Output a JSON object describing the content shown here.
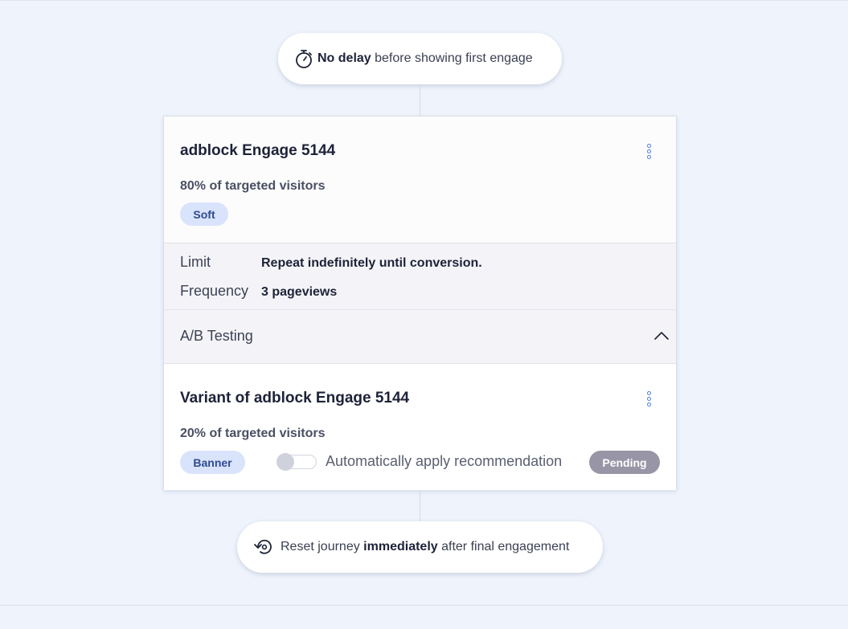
{
  "delay_pill": {
    "bold": "No delay",
    "rest": " before showing first engage",
    "icon": "stopwatch-icon"
  },
  "engage": {
    "title": "adblock Engage 5144",
    "percent_text": "80% of targeted visitors",
    "tag": "Soft",
    "menu_icon": "kebab-menu-icon"
  },
  "settings": {
    "limit_label": "Limit",
    "limit_value": "Repeat indefinitely until conversion.",
    "frequency_label": "Frequency",
    "frequency_value": "3 pageviews"
  },
  "ab_testing": {
    "label": "A/B Testing",
    "expanded": true,
    "icon": "chevron-up-icon"
  },
  "variant": {
    "title": "Variant of adblock Engage 5144",
    "percent_text": "20% of targeted visitors",
    "tag": "Banner",
    "auto_apply_label": "Automatically apply recommendation",
    "auto_apply_on": false,
    "status": "Pending"
  },
  "reset_pill": {
    "prefix": "Reset journey ",
    "bold": "immediately",
    "suffix": " after final engagement",
    "icon": "reset-icon"
  },
  "colors": {
    "background": "#eef3fc",
    "accent": "#4f7be0",
    "tag_bg": "#d9e3fb",
    "tag_text": "#2f4b8f",
    "pending_bg": "#9895a6"
  }
}
